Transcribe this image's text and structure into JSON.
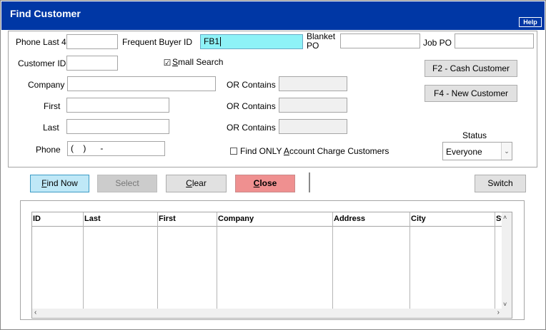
{
  "window": {
    "title": "Find Customer",
    "help_label": "Help"
  },
  "fields": {
    "phone_last4": {
      "label": "Phone Last 4",
      "value": ""
    },
    "frequent_buyer_id": {
      "label": "Frequent Buyer ID",
      "value": "FB1"
    },
    "blanket_po": {
      "label_line1": "Blanket",
      "label_line2": "PO",
      "value": ""
    },
    "job_po": {
      "label": "Job PO",
      "value": ""
    },
    "customer_id": {
      "label": "Customer ID",
      "value": ""
    },
    "small_search": {
      "label_pre": "",
      "label_u": "S",
      "label_post": "mall Search",
      "checked": true,
      "check_glyph": "☑"
    },
    "company": {
      "label": "Company",
      "value": ""
    },
    "first": {
      "label": "First",
      "value": ""
    },
    "last": {
      "label": "Last",
      "value": ""
    },
    "phone": {
      "label": "Phone",
      "value": "(    )      -"
    },
    "or_contains_company": {
      "label": "OR Contains",
      "value": ""
    },
    "or_contains_first": {
      "label": "OR Contains",
      "value": ""
    },
    "or_contains_last": {
      "label": "OR Contains",
      "value": ""
    },
    "account_charge_only": {
      "label_pre": "Find ONLY ",
      "label_u": "A",
      "label_post": "ccount Charge Customers",
      "checked": false
    },
    "status": {
      "label": "Status",
      "value": "Everyone",
      "dropdown_glyph": "⌄"
    }
  },
  "side_buttons": {
    "cash_customer": "F2 - Cash Customer",
    "new_customer": "F4 - New Customer"
  },
  "actions": {
    "find_now": {
      "u": "F",
      "rest": "ind Now"
    },
    "select": {
      "label": "Select"
    },
    "clear": {
      "u": "C",
      "rest": "lear"
    },
    "close": {
      "u": "C",
      "rest": "lose"
    },
    "switch": {
      "label": "Switch"
    }
  },
  "colors": {
    "titlebar": "#0037a5",
    "find_now_bg": "#bfe8f7",
    "find_now_border": "#3c9bc5",
    "close_bg": "#ef9090",
    "focused_input": "#8ef2f7"
  },
  "results_table": {
    "columns": [
      "ID",
      "Last",
      "First",
      "Company",
      "Address",
      "City",
      "St"
    ],
    "rows": [],
    "scroll_up": "˄",
    "scroll_down": "˅",
    "scroll_left": "‹",
    "scroll_right": "›"
  }
}
